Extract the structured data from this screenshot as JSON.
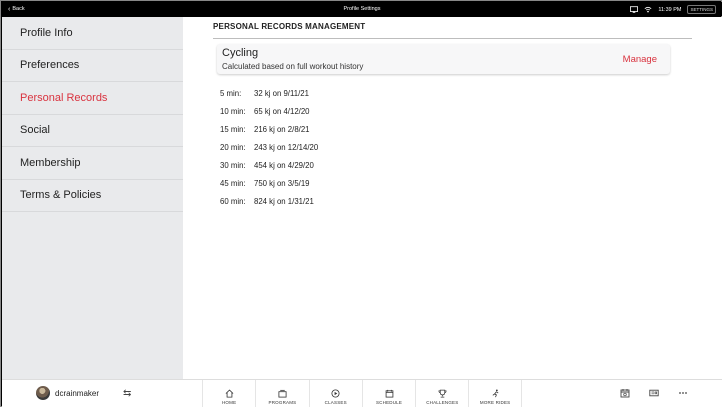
{
  "topbar": {
    "back_label": "Back",
    "title": "Profile Settings",
    "time": "11:39 PM",
    "settings_label": "SETTINGS"
  },
  "sidebar": {
    "items": [
      {
        "label": "Profile Info",
        "active": false
      },
      {
        "label": "Preferences",
        "active": false
      },
      {
        "label": "Personal Records",
        "active": true
      },
      {
        "label": "Social",
        "active": false
      },
      {
        "label": "Membership",
        "active": false
      },
      {
        "label": "Terms & Policies",
        "active": false
      }
    ]
  },
  "main": {
    "section_title": "PERSONAL RECORDS MANAGEMENT",
    "card": {
      "title": "Cycling",
      "subtitle": "Calculated based on full workout history",
      "manage_label": "Manage"
    },
    "records": [
      {
        "duration": "5 min:",
        "value": "32 kj on 9/11/21"
      },
      {
        "duration": "10 min:",
        "value": "65 kj on 4/12/20"
      },
      {
        "duration": "15 min:",
        "value": "216 kj on 2/8/21"
      },
      {
        "duration": "20 min:",
        "value": "243 kj on 12/14/20"
      },
      {
        "duration": "30 min:",
        "value": "454 kj on 4/29/20"
      },
      {
        "duration": "45 min:",
        "value": "750 kj on 3/5/19"
      },
      {
        "duration": "60 min:",
        "value": "824 kj on 1/31/21"
      }
    ]
  },
  "bottombar": {
    "username": "dcrainmaker",
    "tabs": [
      {
        "label": "HOME",
        "icon": "home-icon"
      },
      {
        "label": "PROGRAMS",
        "icon": "programs-icon"
      },
      {
        "label": "CLASSES",
        "icon": "play-icon"
      },
      {
        "label": "SCHEDULE",
        "icon": "calendar-icon"
      },
      {
        "label": "CHALLENGES",
        "icon": "trophy-icon"
      },
      {
        "label": "MORE RIDES",
        "icon": "rider-icon"
      }
    ]
  },
  "colors": {
    "accent": "#d9333f",
    "sidebar_bg": "#e9eaec",
    "topbar_bg": "#000000"
  }
}
